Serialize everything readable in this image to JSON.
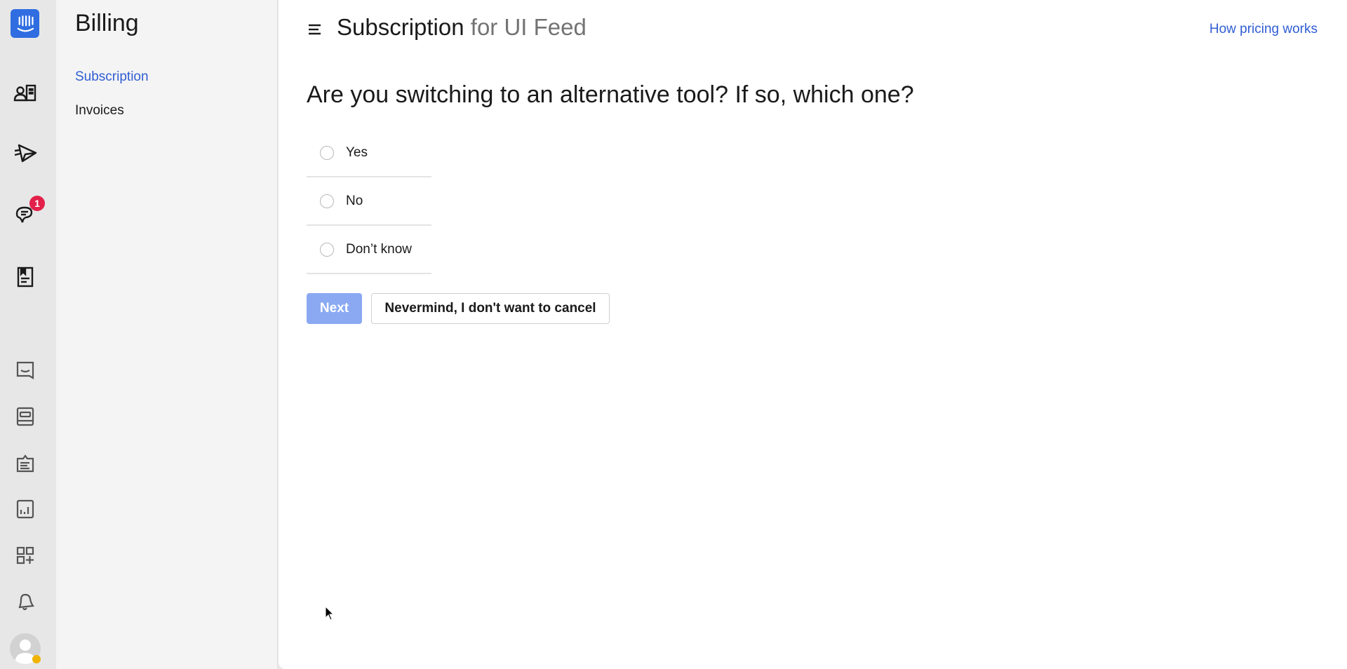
{
  "rail": {
    "logo": "intercom-logo",
    "badge_count": "1",
    "top_icons": [
      "contacts-icon",
      "outbound-icon",
      "inbox-icon",
      "articles-icon"
    ],
    "bottom_icons": [
      "messenger-icon",
      "knowledge-icon",
      "operator-icon",
      "reports-icon",
      "apps-icon",
      "notifications-icon"
    ],
    "avatar_status_color": "#f0b400"
  },
  "subnav": {
    "title": "Billing",
    "items": [
      {
        "label": "Subscription",
        "active": true
      },
      {
        "label": "Invoices",
        "active": false
      }
    ]
  },
  "header": {
    "title": "Subscription",
    "title_suffix": "for UI Feed",
    "pricing_link": "How pricing works"
  },
  "form": {
    "question": "Are you switching to an alternative tool? If so, which one?",
    "options": [
      {
        "label": "Yes",
        "selected": false
      },
      {
        "label": "No",
        "selected": false
      },
      {
        "label": "Don’t know",
        "selected": false
      }
    ],
    "next_label": "Next",
    "next_disabled": true,
    "cancel_label": "Nevermind, I don't want to cancel"
  },
  "colors": {
    "accent": "#2f5dd1",
    "brand": "#2f6de1",
    "messenger": "#2631d6",
    "badge": "#e3204a",
    "next_disabled": "#8aa9f2"
  }
}
